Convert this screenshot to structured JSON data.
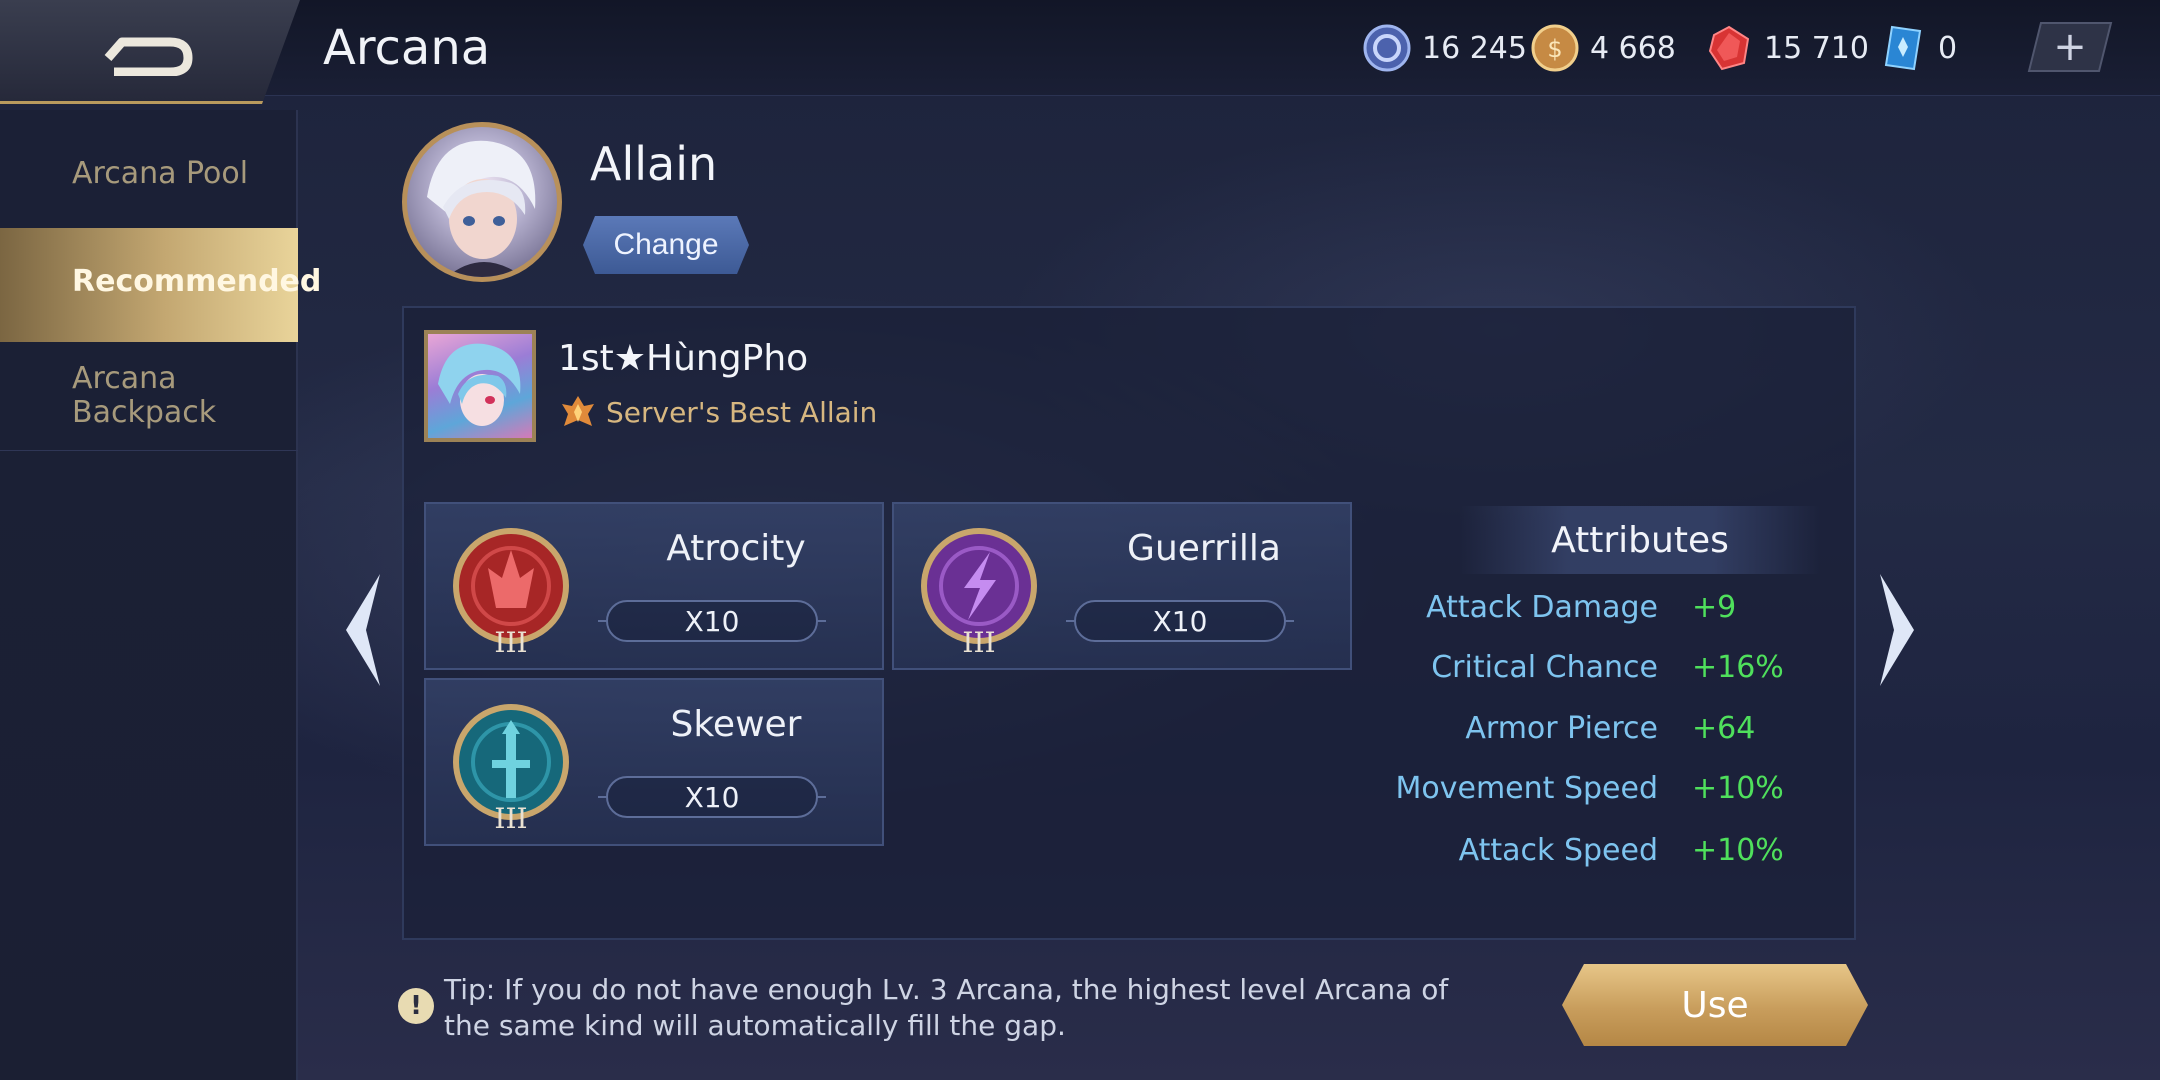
{
  "header": {
    "title": "Arcana",
    "currencies": [
      {
        "icon": "silver-coin-icon",
        "value": "16 245",
        "color": "#6f8fd8"
      },
      {
        "icon": "gold-coin-icon",
        "value": "4 668",
        "color": "#d7a35a"
      },
      {
        "icon": "ruby-gem-icon",
        "value": "15 710",
        "color": "#d83a3a"
      },
      {
        "icon": "blue-card-icon",
        "value": "0",
        "color": "#3aa7e8"
      }
    ],
    "plus_label": "+"
  },
  "sidebar": {
    "items": [
      {
        "label": "Arcana Pool",
        "active": false
      },
      {
        "label": "Recommended",
        "active": true
      },
      {
        "label": "Arcana Backpack",
        "active": false
      }
    ]
  },
  "hero": {
    "name": "Allain",
    "change_label": "Change"
  },
  "player": {
    "name": "1st★HùngPho",
    "subtitle": "Server's Best Allain"
  },
  "arcana": [
    {
      "name": "Atrocity",
      "count": "X10",
      "level": "III",
      "color": "#b62a2a",
      "icon": "red-arcana-icon"
    },
    {
      "name": "Guerrilla",
      "count": "X10",
      "level": "III",
      "color": "#7a3aa6",
      "icon": "purple-arcana-icon"
    },
    {
      "name": "Skewer",
      "count": "X10",
      "level": "III",
      "color": "#1f7a8c",
      "icon": "green-arcana-icon"
    }
  ],
  "attributes": {
    "heading": "Attributes",
    "rows": [
      {
        "label": "Attack Damage",
        "value": "+9"
      },
      {
        "label": "Critical Chance",
        "value": "+16%"
      },
      {
        "label": "Armor Pierce",
        "value": "+64"
      },
      {
        "label": "Movement Speed",
        "value": "+10%"
      },
      {
        "label": "Attack Speed",
        "value": "+10%"
      }
    ]
  },
  "tip": {
    "icon_label": "!",
    "text": "Tip: If you do not have enough Lv. 3 Arcana, the highest level Arcana of the same kind will automatically fill the gap."
  },
  "use_label": "Use"
}
